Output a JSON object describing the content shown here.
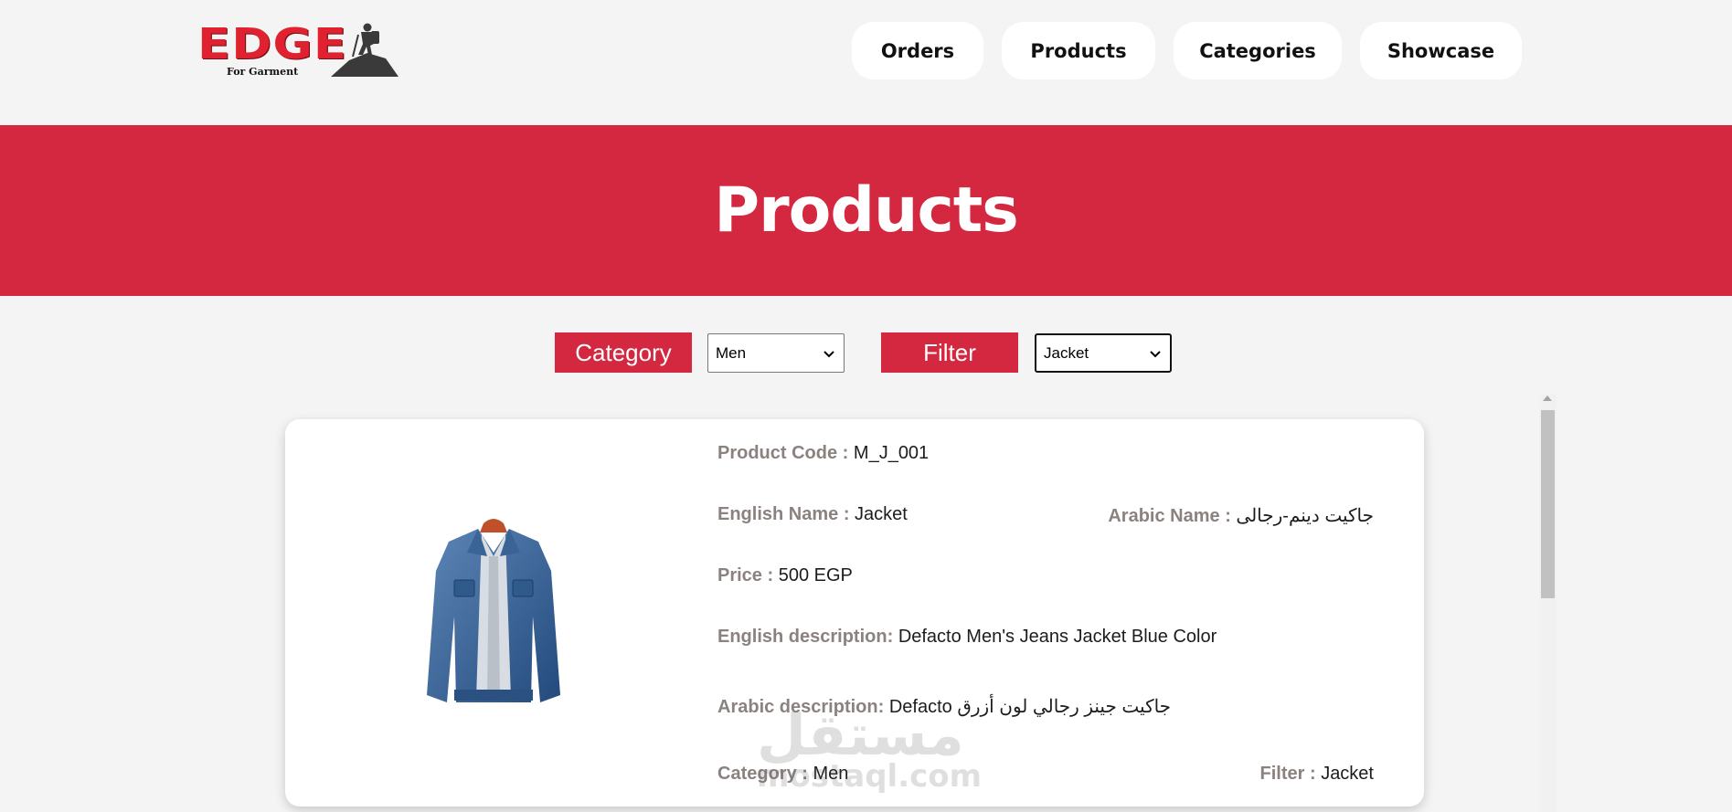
{
  "brand": {
    "logo_text": "EDGE",
    "logo_sub": "For Garment"
  },
  "nav": {
    "orders": "Orders",
    "products": "Products",
    "categories": "Categories",
    "showcase": "Showcase"
  },
  "page": {
    "title": "Products"
  },
  "filters": {
    "category_label": "Category",
    "category_value": "Men",
    "filter_label": "Filter",
    "filter_value": "Jacket"
  },
  "product": {
    "code_label": "Product Code :",
    "code": "M_J_001",
    "english_name_label": "English Name :",
    "english_name": "Jacket",
    "arabic_name_label": "Arabic Name :",
    "arabic_name": "جاكيت دينم-رجالى",
    "price_label": "Price :",
    "price": "500 EGP",
    "english_desc_label": "English description:",
    "english_desc": "Defacto Men's Jeans Jacket Blue Color",
    "arabic_desc_label": "Arabic description:",
    "arabic_desc": "Defacto جاكيت جينز رجالي لون أزرق",
    "category_label": "Category :",
    "category": "Men",
    "filter_label": "Filter :",
    "filter": "Jacket"
  },
  "watermark": {
    "arabic": "مستقل",
    "latin": "mostaql.com"
  },
  "colors": {
    "accent": "#d42740",
    "background": "#f4f4f4",
    "label_gray": "#8b8280"
  }
}
